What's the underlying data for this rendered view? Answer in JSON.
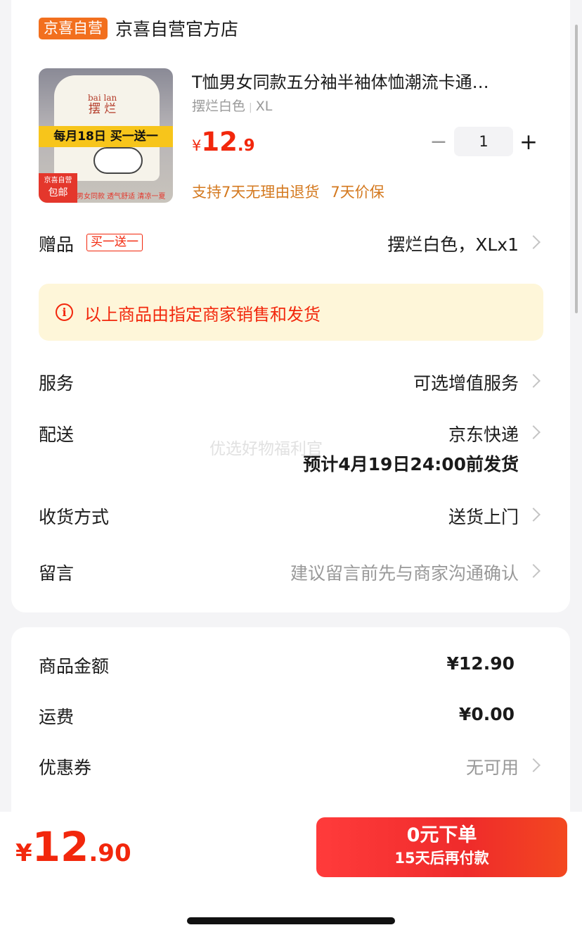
{
  "store": {
    "badge": "京喜自营",
    "name": "京喜自营官方店"
  },
  "product": {
    "title": "T恤男女同款五分袖半袖体恤潮流卡通…",
    "spec_color": "摆烂白色",
    "spec_size": "XL",
    "price_currency": "¥",
    "price_int": "12",
    "price_dec": ".9",
    "quantity": "1",
    "guarantee_return": "支持7天无理由退货",
    "guarantee_price": "7天价保",
    "image": {
      "shirt_text": "bai  lan",
      "shirt_text_cn": "摆 烂",
      "promo_text": "每月18日 买一送一",
      "badge_top": "京喜自营",
      "badge_bottom": "包邮",
      "bottom_caption": "男女同款 透气舒适 清凉一夏"
    }
  },
  "rows": {
    "gift_label": "赠品",
    "gift_tag": "买一送一",
    "gift_value": "摆烂白色，XLx1",
    "notice_icon": "i",
    "notice": "以上商品由指定商家销售和发货",
    "service_label": "服务",
    "service_value": "可选增值服务",
    "delivery_label": "配送",
    "delivery_value": "京东快递",
    "delivery_eta": "预计4月19日24:00前发货",
    "receive_label": "收货方式",
    "receive_value": "送货上门",
    "message_label": "留言",
    "message_placeholder": "建议留言前先与商家沟通确认",
    "watermark": "优选好物福利官"
  },
  "summary": {
    "goods_label": "商品金额",
    "goods_amount": "¥12.90",
    "freight_label": "运费",
    "freight_amount": "¥0.00",
    "coupon_label": "优惠券",
    "coupon_value": "无可用"
  },
  "bottom": {
    "total_currency": "¥",
    "total_int": "12",
    "total_dec": ".90",
    "pay_line1": "0元下单",
    "pay_line2": "15天后再付款"
  },
  "colors": {
    "accent_red": "#f2270c",
    "store_badge": "#f26f1e",
    "guarantee_orange": "#d4791f",
    "notice_bg": "#fef6d9"
  },
  "icons": {
    "notice": "info-circle-icon",
    "row_arrow": "chevron-right-icon",
    "minus": "minus-icon",
    "plus": "plus-icon"
  }
}
